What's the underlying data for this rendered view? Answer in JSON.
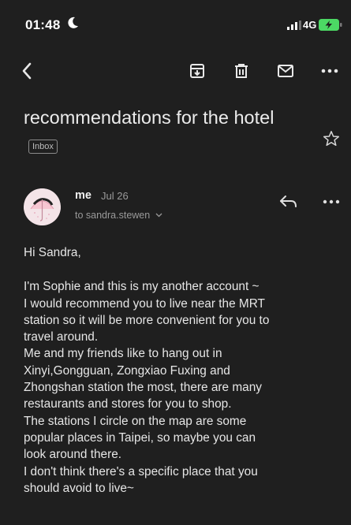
{
  "status": {
    "time": "01:48",
    "network": "4G"
  },
  "toolbar": {
    "back_icon": "chevron-left-icon",
    "archive_icon": "archive-icon",
    "delete_icon": "trash-icon",
    "mark_unread_icon": "mail-icon",
    "more_icon": "more-horizontal-icon"
  },
  "subject": {
    "text": "recommendations for the hotel",
    "label": "Inbox"
  },
  "message": {
    "sender": "me",
    "date": "Jul 26",
    "recipient": "to sandra.stewen",
    "greeting": "Hi Sandra,",
    "lines": [
      "I'm Sophie and this is my another account ~",
      "I would recommend you to live near the MRT",
      "station so it will be more convenient for you to",
      "travel around.",
      "Me and my friends like to hang out in",
      "Xinyi,Gongguan, Zongxiao Fuxing and",
      "Zhongshan station the most, there are many",
      "restaurants and stores for you to shop.",
      "The stations I circle on the map are some",
      "popular places in Taipei, so maybe you can",
      "look around there.",
      "I don't think there's a specific place that you",
      "should avoid to live~"
    ]
  },
  "colors": {
    "background": "#1f1f1f",
    "text": "#e6e6e6",
    "muted": "#9a9a9a",
    "battery": "#4cd964"
  }
}
